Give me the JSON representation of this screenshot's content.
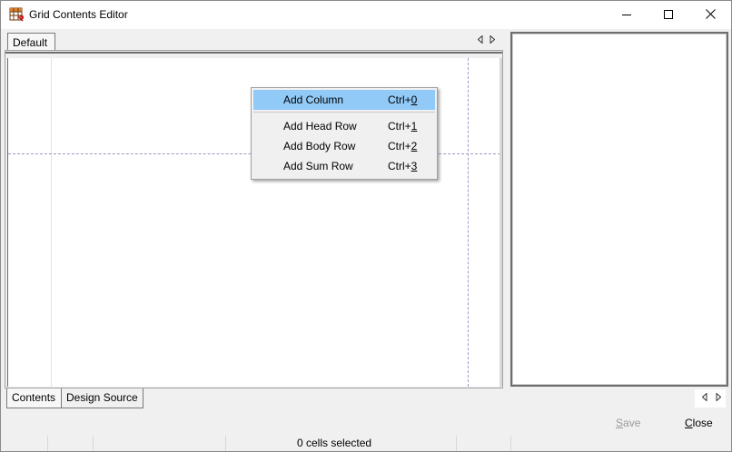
{
  "window": {
    "title": "Grid Contents Editor"
  },
  "top_tabs": [
    {
      "label": "Default",
      "active": true
    }
  ],
  "bottom_tabs": [
    {
      "label": "Contents",
      "active": true
    },
    {
      "label": "Design Source",
      "active": false
    }
  ],
  "context_menu": {
    "items": [
      {
        "label": "Add Column",
        "shortcut_prefix": "Ctrl+",
        "shortcut_key": "0",
        "highlighted": true
      },
      {
        "label": "Add Head Row",
        "shortcut_prefix": "Ctrl+",
        "shortcut_key": "1",
        "highlighted": false
      },
      {
        "label": "Add Body Row",
        "shortcut_prefix": "Ctrl+",
        "shortcut_key": "2",
        "highlighted": false
      },
      {
        "label": "Add Sum Row",
        "shortcut_prefix": "Ctrl+",
        "shortcut_key": "3",
        "highlighted": false
      }
    ]
  },
  "footer": {
    "save_prefix": "",
    "save_key": "S",
    "save_rest": "ave",
    "save_enabled": false,
    "close_prefix": "",
    "close_key": "C",
    "close_rest": "lose"
  },
  "status": {
    "text": "0 cells selected"
  },
  "colors": {
    "menu_highlight": "#91c9f7",
    "guide_dash": "#9a9ac8",
    "disabled_text": "#9a9a9a"
  },
  "icons": {
    "app": "grid-table-icon",
    "minimize": "minimize-icon",
    "maximize": "maximize-icon",
    "close": "close-icon",
    "scroll_left": "triangle-left-icon",
    "scroll_right": "triangle-right-icon"
  }
}
